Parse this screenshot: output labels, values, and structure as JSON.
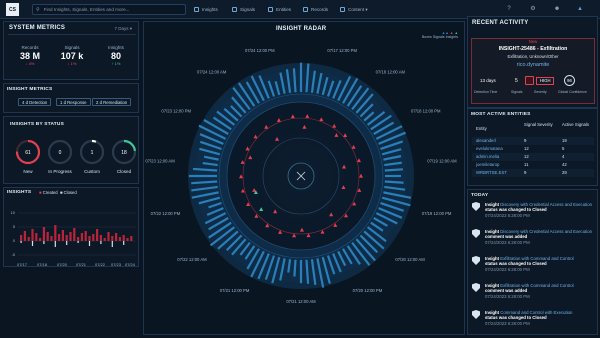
{
  "search": {
    "placeholder": "Find Insights, Signals, Entities and more..."
  },
  "nav": {
    "insights": "Insights",
    "signals": "Signals",
    "entities": "Entities",
    "records": "Records",
    "content": "Content ▾"
  },
  "system_metrics": {
    "title": "SYSTEM METRICS",
    "range": "7 Days ▾",
    "records": {
      "label": "Records",
      "value": "38 M",
      "change": "↓ 4%"
    },
    "signals": {
      "label": "Signals",
      "value": "107 k",
      "change": "↓ 1%"
    },
    "insights": {
      "label": "Insights",
      "value": "80",
      "change": "↑ 1%"
    }
  },
  "insight_metrics": {
    "title": "INSIGHT METRICS",
    "detection": "4 d  Detection",
    "response": "1 d  Response",
    "remediation": "2 d  Remediation"
  },
  "insights_by_status": {
    "title": "INSIGHTS BY STATUS",
    "new": {
      "label": "New",
      "value": "61"
    },
    "in_progress": {
      "label": "In Progress",
      "value": "0"
    },
    "custom": {
      "label": "Custom",
      "value": "1"
    },
    "closed": {
      "label": "Closed",
      "value": "18"
    }
  },
  "insights_chart": {
    "title": "INSIGHTS",
    "legend_created": "Created",
    "legend_closed": "Closed",
    "y_ticks": [
      "10",
      "5",
      "0",
      "-5"
    ],
    "x_ticks": [
      "07/17",
      "07/18",
      "07/20",
      "07/21",
      "07/22",
      "07/23",
      "07/24"
    ]
  },
  "radar": {
    "title": "INSIGHT RADAR",
    "legend_boxes": "Boxes",
    "legend_signals": "Signals",
    "legend_insights": "Insights",
    "time_labels": [
      "07/24 12:00 PM",
      "07/24 12:00 AM",
      "07/23 12:00 PM",
      "07/23 12:00 AM",
      "07/22 12:00 PM",
      "07/22 12:00 AM",
      "07/21 12:00 PM",
      "07/21 12:00 AM",
      "07/20 12:00 PM",
      "07/20 12:00 AM",
      "07/19 12:00 PM",
      "07/19 12:00 AM",
      "07/18 12:00 PM",
      "07/18 12:00 AM",
      "07/17 12:00 PM"
    ]
  },
  "recent_activity": {
    "title": "RECENT ACTIVITY",
    "status": "New",
    "insight_id": "INSIGHT-25486 - Exfiltration",
    "subtitle": "Exfiltration, Unknown/Other",
    "entity": "rico.dynamite",
    "detection_time": "13 days",
    "signals": "5",
    "severity": "HIGH",
    "confidence": "96",
    "detection_label": "Detection Time",
    "signals_label": "Signals",
    "severity_label": "Severity",
    "confidence_label": "Global Confidence"
  },
  "active_entities": {
    "title": "MOST ACTIVE ENTITIES",
    "headers": [
      "Entity",
      "Signal Severity",
      "Active Signals"
    ],
    "rows": [
      [
        "alexanderl",
        "9",
        "19"
      ],
      [
        "evelukmatana",
        "12",
        "5"
      ],
      [
        "admin.melia",
        "12",
        "4"
      ],
      [
        "joemiletarop",
        "11",
        "42"
      ],
      [
        "WRBRTSE.EST",
        "9",
        "29"
      ]
    ]
  },
  "today": {
    "title": "TODAY",
    "items": [
      {
        "a": "Insight",
        "b": "Discovery with Credential Access and Execution",
        "c": "status was changed to Closed",
        "t": "07/24/2023 6:28:00 PM"
      },
      {
        "a": "Insight",
        "b": "Discovery with Credential Access and Execution",
        "c": "comment was added",
        "t": "07/24/2023 6:28:00 PM"
      },
      {
        "a": "Insight",
        "b": "Exfiltration with Command and Control",
        "c": "status was changed to Closed",
        "t": "07/24/2023 6:28:00 PM"
      },
      {
        "a": "Insight",
        "b": "Exfiltration with Command and Control",
        "c": "comment was added",
        "t": "07/24/2023 6:28:00 PM"
      },
      {
        "a": "Insight",
        "b": "Command and Control with Execution",
        "c": "status was changed to Closed",
        "t": "07/24/2023 6:28:00 PM"
      }
    ]
  }
}
